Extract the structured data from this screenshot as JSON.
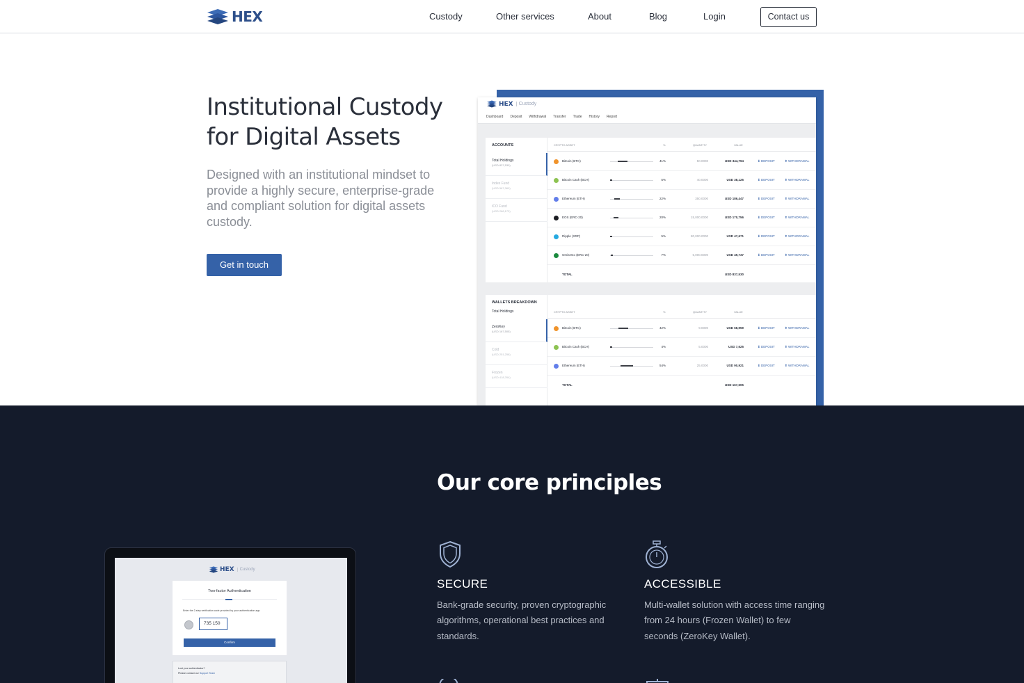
{
  "nav": {
    "logo_text": "HEX",
    "links": [
      "Custody",
      "Other services",
      "About",
      "Blog",
      "Login"
    ],
    "contact_label": "Contact us"
  },
  "hero": {
    "title_line1": "Institutional Custody",
    "title_line2": "for Digital Assets",
    "subtitle": "Designed with an institutional mindset to provide a highly secure, enterprise-grade and compliant solution for digital assets custody.",
    "cta_label": "Get in touch"
  },
  "dashboard": {
    "logo_text": "HEX",
    "logo_sub": "Custody",
    "menu": [
      "Dashboard",
      "Deposit",
      "Withdrawal",
      "Transfer",
      "Trade",
      "History",
      "Report"
    ],
    "accounts": {
      "title": "ACCOUNTS",
      "items": [
        {
          "name": "Total Holdings",
          "value": "(USD 837,530)"
        },
        {
          "name": "Index Fund",
          "value": "(USD 567,360)"
        },
        {
          "name": "ICO Fund",
          "value": "(USD 268,173)"
        }
      ],
      "headers": {
        "asset": "CRYPTO ASSET",
        "pct": "%",
        "qty": "QUANTITY",
        "value": "VALUE"
      },
      "rows": [
        {
          "name": "Bitcoin (BTC)",
          "pct": "41%",
          "qty": "50.0000",
          "value": "USD 344,794",
          "share": 0.41,
          "color": "#f0932b"
        },
        {
          "name": "Bitcoin Cash (BCH)",
          "pct": "5%",
          "qty": "40.0000",
          "value": "USD 38,125",
          "share": 0.05,
          "color": "#8dc351"
        },
        {
          "name": "Ethereum (ETH)",
          "pct": "22%",
          "qty": "350.0000",
          "value": "USD 186,447",
          "share": 0.22,
          "color": "#627eea"
        },
        {
          "name": "EOS (ERC-20)",
          "pct": "20%",
          "qty": "15,000.0000",
          "value": "USD 170,756",
          "share": 0.2,
          "color": "#1b1d22"
        },
        {
          "name": "Ripple (XRP)",
          "pct": "5%",
          "qty": "80,000.0000",
          "value": "USD 47,671",
          "share": 0.05,
          "color": "#25a9e0"
        },
        {
          "name": "OmiseGo (ERC-20)",
          "pct": "7%",
          "qty": "5,000.0000",
          "value": "USD 49,737",
          "share": 0.07,
          "color": "#1a8a3e"
        }
      ],
      "total_label": "TOTAL",
      "total_value": "USD 837,530"
    },
    "wallets": {
      "title": "WALLETS BREAKDOWN",
      "subtitle": "Total Holdings",
      "items": [
        {
          "name": "ZeroKey",
          "value": "(USD 167,505)"
        },
        {
          "name": "Cold",
          "value": "(USD 251,258)"
        },
        {
          "name": "Frozen",
          "value": "(USD 418,764)"
        }
      ],
      "headers": {
        "asset": "CRYPTO ASSET",
        "pct": "%",
        "qty": "QUANTITY",
        "value": "VALUE"
      },
      "rows": [
        {
          "name": "Bitcoin (BTC)",
          "pct": "42%",
          "qty": "9.0000",
          "value": "USD 68,959",
          "share": 0.42,
          "color": "#f0932b"
        },
        {
          "name": "Bitcoin Cash (BCH)",
          "pct": "4%",
          "qty": "5.0000",
          "value": "USD 7,625",
          "share": 0.04,
          "color": "#8dc351"
        },
        {
          "name": "Ethereum (ETH)",
          "pct": "54%",
          "qty": "25.0000",
          "value": "USD 90,921",
          "share": 0.54,
          "color": "#627eea"
        }
      ],
      "total_label": "TOTAL",
      "total_value": "USD 167,505"
    },
    "deposit_label": "⬇ DEPOSIT",
    "withdrawal_label": "⬆ WITHDRAWAL"
  },
  "principles": {
    "title": "Our core principles",
    "laptop": {
      "logo_text": "HEX",
      "logo_sub": "Custody",
      "card_title": "Two-factor Authentication",
      "help_text": "Enter the 2-step verification code provided by your authentication app",
      "code_value": "735 150",
      "confirm_label": "Confirm",
      "lost_line1": "Lost your authenticator?",
      "lost_line2_prefix": "Please contact our",
      "lost_line2_link": "Support Team"
    },
    "features": [
      {
        "title": "SECURE",
        "text": "Bank-grade security, proven cryptographic algorithms, operational best practices and standards.",
        "icon": "shield-icon"
      },
      {
        "title": "ACCESSIBLE",
        "text": "Multi-wallet solution with access time ranging from 24 hours (Frozen Wallet) to few seconds (ZeroKey Wallet).",
        "icon": "stopwatch-icon"
      }
    ]
  },
  "colors": {
    "brand": "#3562a8",
    "dark_bg": "#141b2b"
  }
}
